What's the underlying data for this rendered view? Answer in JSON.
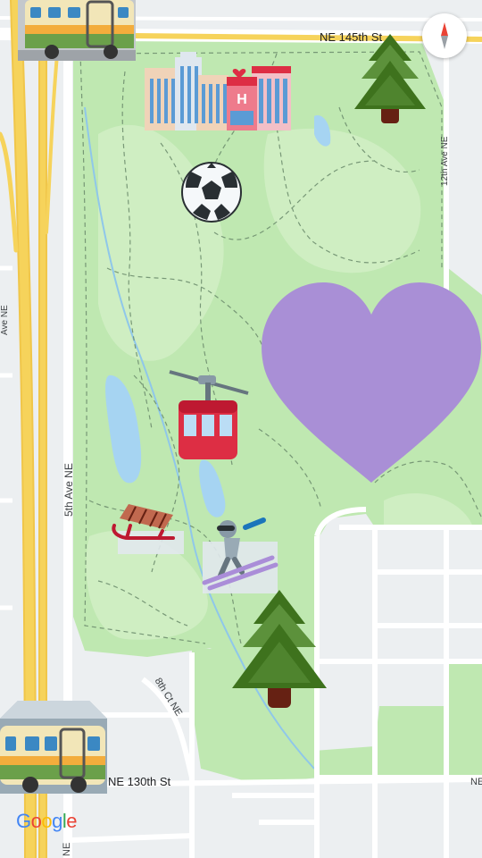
{
  "map": {
    "streets": {
      "ne145": "NE 145th St",
      "ne130": "NE 130th St",
      "ave5": "5th Ave NE",
      "ave12": "12th Ave NE",
      "ct8": "8th Ct NE",
      "ne_fragment": "NE",
      "left_fragment": "Ave NE"
    },
    "attribution": {
      "letters": [
        "G",
        "o",
        "o",
        "g",
        "l",
        "e"
      ],
      "colors": [
        "#4285F4",
        "#EA4335",
        "#FBBC05",
        "#4285F4",
        "#34A853",
        "#EA4335"
      ]
    },
    "compass": {
      "north_color": "#EA4335",
      "south_color": "#9aa0a6"
    },
    "colors": {
      "park": "#bfe8b1",
      "park_light": "#d8f2cd",
      "highway": "#f6d35b",
      "road": "#ffffff",
      "water": "#a6d4f2",
      "heart": "#a98fd6"
    }
  },
  "stickers": [
    "train-emoji",
    "buildings-emoji",
    "hotel-emoji",
    "pine-tree-emoji",
    "soccer-ball-emoji",
    "heart-emoji",
    "aerial-tramway-emoji",
    "sled-emoji",
    "skier-emoji",
    "pine-tree-emoji",
    "train-emoji"
  ]
}
